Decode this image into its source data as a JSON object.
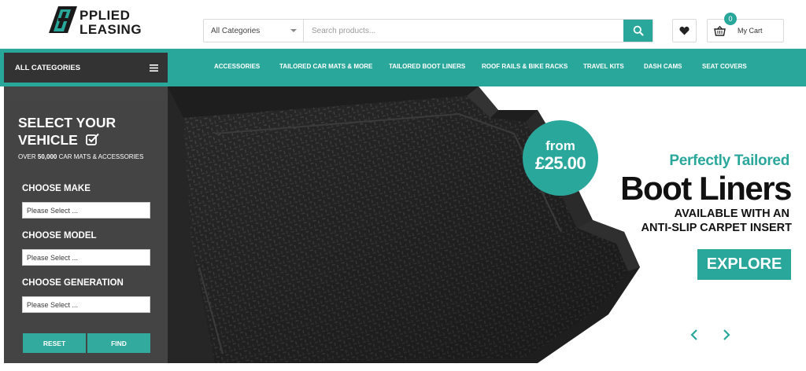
{
  "brand": {
    "line1": "PPLIED",
    "line2": "LEASING"
  },
  "search": {
    "category_selected": "All Categories",
    "placeholder": "Search products..."
  },
  "cart": {
    "count": "0",
    "label": "My Cart"
  },
  "nav": {
    "all_categories": "ALL CATEGORIES",
    "items": [
      "ACCESSORIES",
      "TAILORED CAR MATS & MORE",
      "TAILORED BOOT LINERS",
      "ROOF RAILS & BIKE RACKS",
      "TRAVEL KITS",
      "DASH CAMS",
      "SEAT COVERS"
    ]
  },
  "vehicle_selector": {
    "title_line1": "SELECT YOUR",
    "title_line2": "VEHICLE",
    "subtitle_prefix": "OVER ",
    "subtitle_bold": "50,000",
    "subtitle_suffix": " CAR MATS & ACCESSORIES",
    "make_label": "CHOOSE MAKE",
    "make_value": "Please Select ...",
    "model_label": "CHOOSE MODEL",
    "model_value": "Please Select ...",
    "generation_label": "CHOOSE GENERATION",
    "generation_value": "Please Select ...",
    "reset_label": "RESET",
    "find_label": "FIND"
  },
  "hero": {
    "price_from": "from",
    "price_value": "£25.00",
    "subtitle": "Perfectly Tailored",
    "title": "Boot Liners",
    "line1": "AVAILABLE WITH AN",
    "line2": "ANTI-SLIP CARPET INSERT",
    "cta": "EXPLORE"
  },
  "colors": {
    "accent": "#2aa79b",
    "dark_panel": "#333333"
  },
  "icons": [
    "search-icon",
    "heart-icon",
    "basket-icon",
    "menu-icon",
    "checkbox-icon",
    "chevron-left-icon",
    "chevron-right-icon"
  ]
}
